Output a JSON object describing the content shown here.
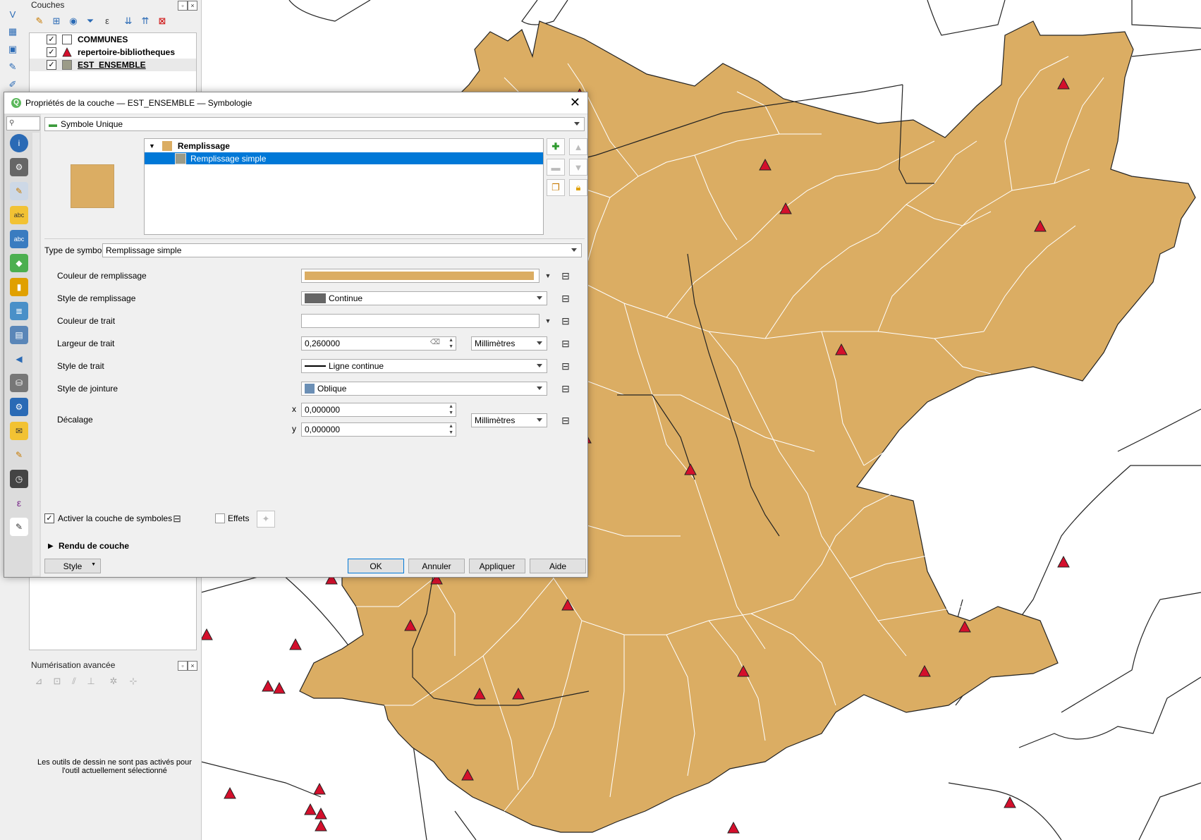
{
  "layers_panel": {
    "title": "Couches",
    "layers": [
      {
        "name": "COMMUNES",
        "checked": "✓",
        "legend": "white-square"
      },
      {
        "name": "repertoire-bibliotheques",
        "checked": "✓",
        "legend": "red-triangle"
      },
      {
        "name": "EST_ENSEMBLE",
        "checked": "✓",
        "legend": "grey-square"
      }
    ]
  },
  "advanced_digitizing": {
    "title": "Numérisation avancée",
    "message": "Les outils de dessin ne sont pas activés pour l'outil actuellement sélectionné"
  },
  "dialog": {
    "title": "Propriétés de la couche — EST_ENSEMBLE — Symbologie",
    "renderer": "Symbole Unique",
    "symbol_tree": {
      "root": "Remplissage",
      "child": "Remplissage simple"
    },
    "symbol_type_label": "Type de symbole",
    "symbol_type_value": "Remplissage simple",
    "properties": {
      "fill_color_label": "Couleur de remplissage",
      "fill_style_label": "Style de remplissage",
      "fill_style_value": "Continue",
      "stroke_color_label": "Couleur de trait",
      "stroke_width_label": "Largeur de trait",
      "stroke_width_value": "0,260000",
      "stroke_width_unit": "Millimètres",
      "stroke_style_label": "Style de trait",
      "stroke_style_value": "Ligne continue",
      "join_style_label": "Style de jointure",
      "join_style_value": "Oblique",
      "offset_label": "Décalage",
      "offset_x_label": "x",
      "offset_x_value": "0,000000",
      "offset_y_label": "y",
      "offset_y_value": "0,000000",
      "offset_unit": "Millimètres"
    },
    "enable_layer_label": "Activer la couche de symboles",
    "enable_layer_check": "✓",
    "effects_label": "Effets",
    "layer_rendering_label": "Rendu de couche",
    "buttons": {
      "style": "Style",
      "ok": "OK",
      "cancel": "Annuler",
      "apply": "Appliquer",
      "help": "Aide"
    }
  },
  "colors": {
    "fill": "#dbad63",
    "marker": "#d40f2c",
    "selection": "#0078d7"
  }
}
